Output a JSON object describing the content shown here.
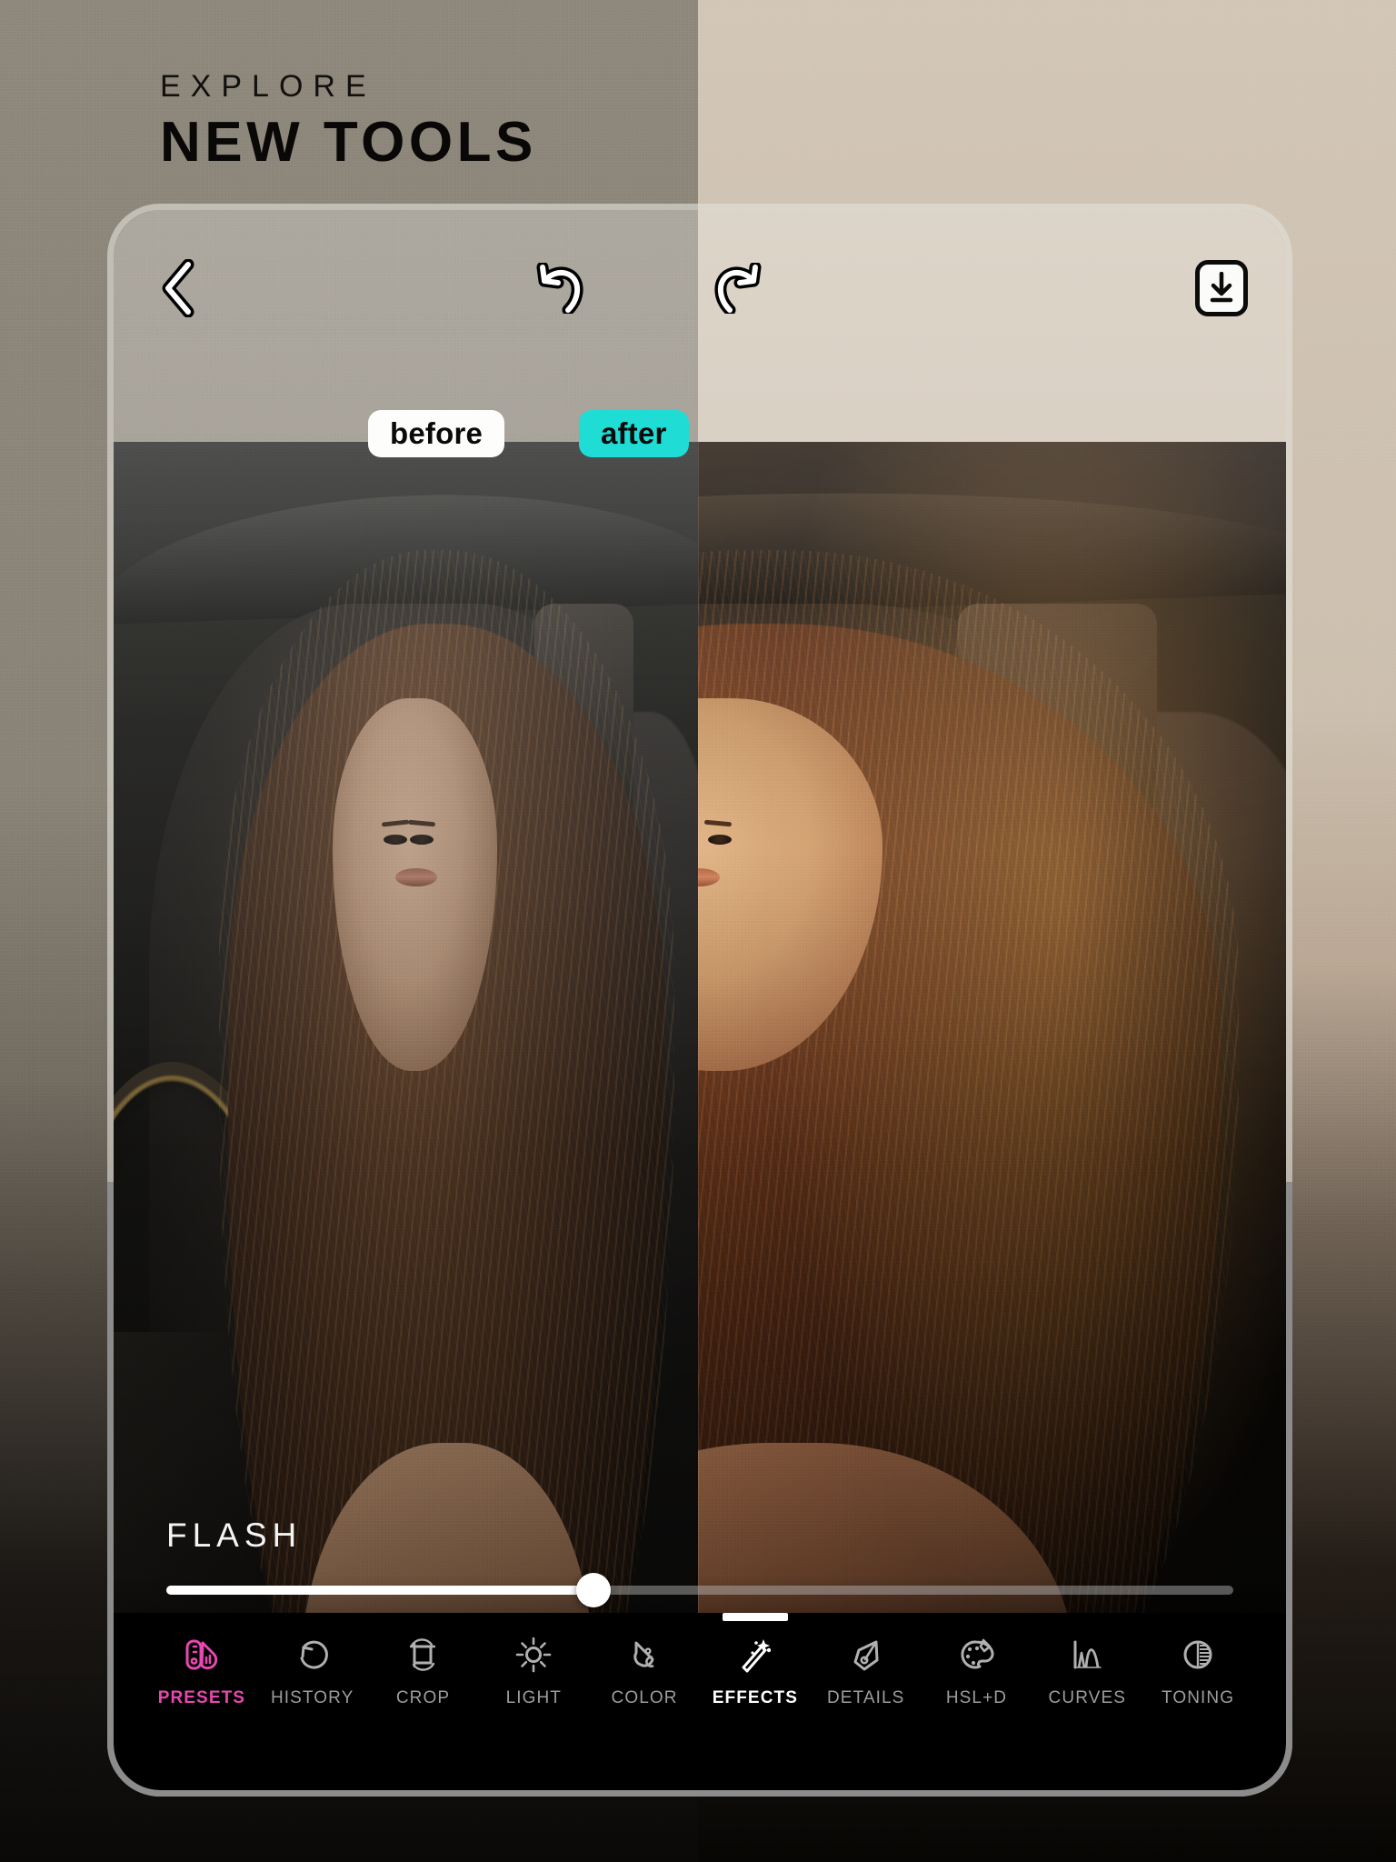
{
  "promo": {
    "kicker": "EXPLORE",
    "title": "NEW TOOLS"
  },
  "colors": {
    "accent_pink": "#e648b0",
    "after_chip": "#1fdcd4",
    "active_white": "#ffffff",
    "bg_left": "#8e887c",
    "bg_right": "#d2c6b7",
    "frame": "#8c8c8c"
  },
  "editor": {
    "toolbar_top": {
      "back": {
        "label": "Back",
        "icon": "chevron-left-icon"
      },
      "undo": {
        "label": "Undo",
        "icon": "undo-arrow-icon"
      },
      "redo": {
        "label": "Redo",
        "icon": "redo-arrow-icon"
      },
      "save": {
        "label": "Save",
        "icon": "download-icon"
      }
    },
    "compare": {
      "before_label": "before",
      "after_label": "after"
    },
    "adjustment": {
      "name": "FLASH",
      "value": 40,
      "min": 0,
      "max": 100
    },
    "tabs": [
      {
        "label": "PRESETS",
        "icon": "presets-icon",
        "state": "accent"
      },
      {
        "label": "HISTORY",
        "icon": "history-icon",
        "state": "normal"
      },
      {
        "label": "CROP",
        "icon": "crop-icon",
        "state": "normal"
      },
      {
        "label": "LIGHT",
        "icon": "sun-icon",
        "state": "normal"
      },
      {
        "label": "COLOR",
        "icon": "color-drop-icon",
        "state": "normal"
      },
      {
        "label": "EFFECTS",
        "icon": "magic-wand-icon",
        "state": "active"
      },
      {
        "label": "DETAILS",
        "icon": "pen-nib-icon",
        "state": "normal"
      },
      {
        "label": "HSL+D",
        "icon": "palette-icon",
        "state": "normal"
      },
      {
        "label": "CURVES",
        "icon": "curves-icon",
        "state": "normal"
      },
      {
        "label": "TONING",
        "icon": "toning-icon",
        "state": "normal"
      }
    ]
  }
}
